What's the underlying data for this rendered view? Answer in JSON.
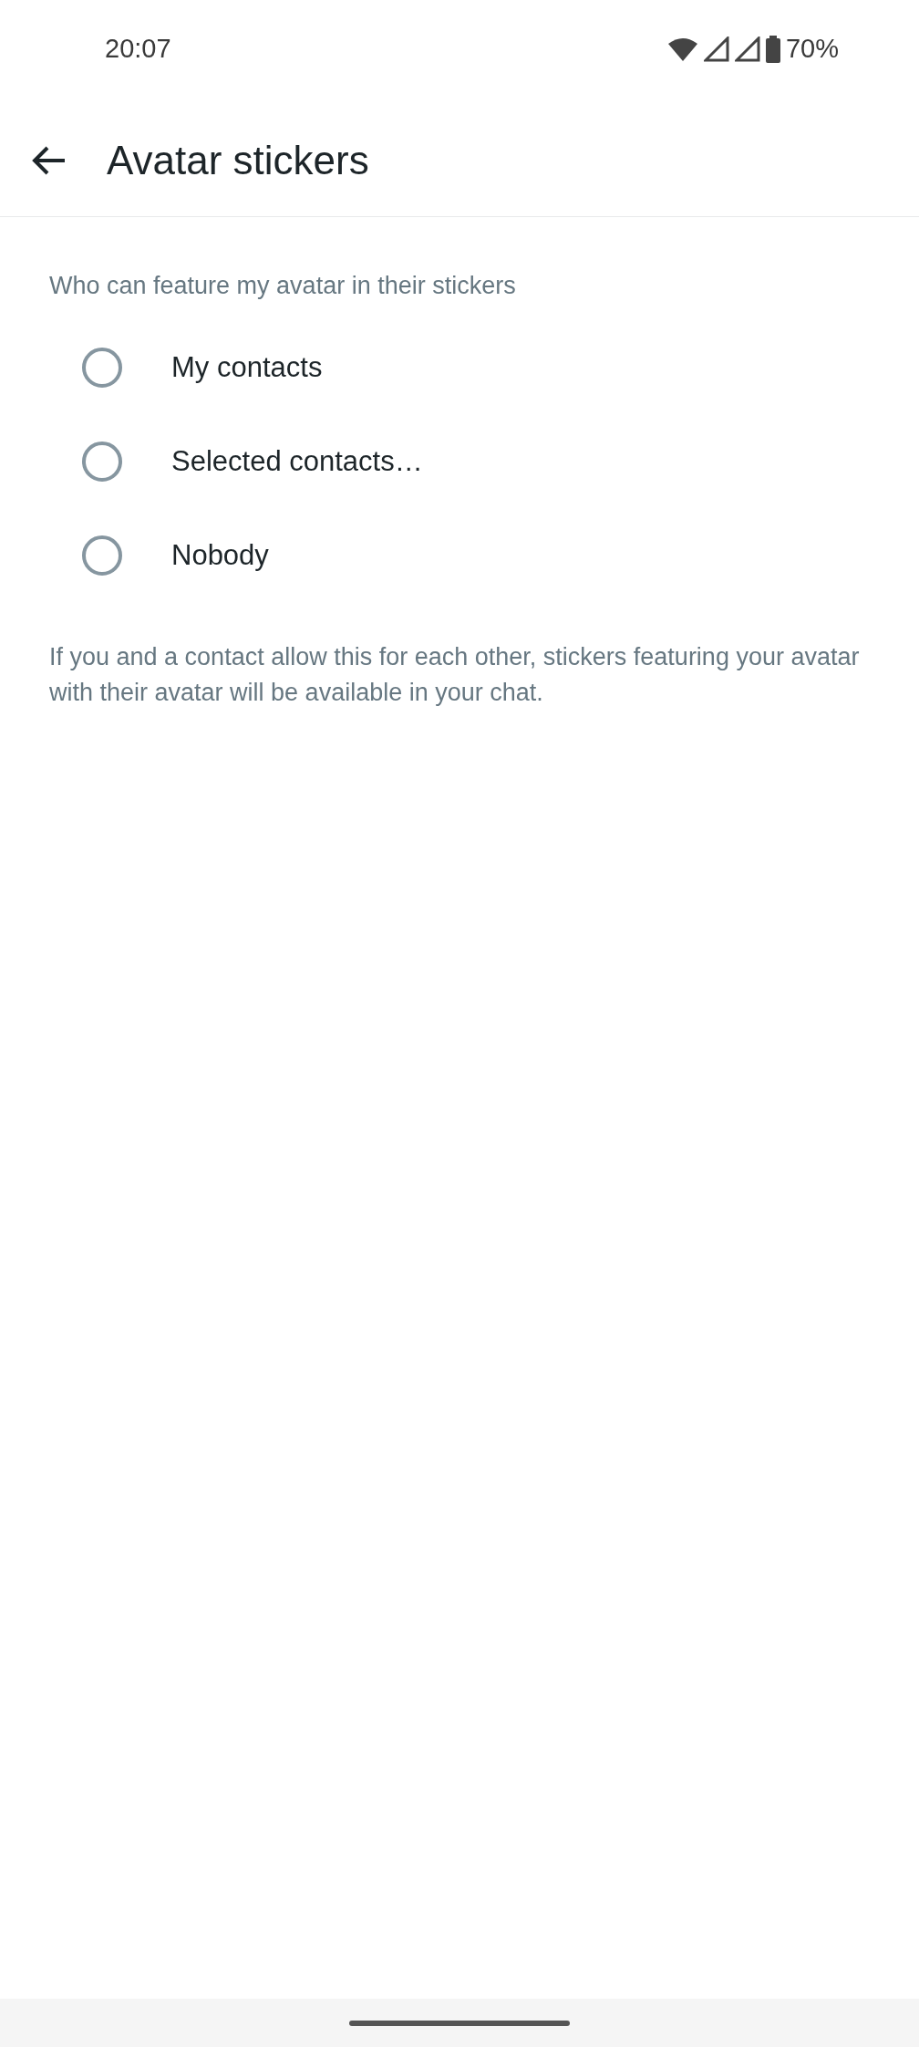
{
  "status_bar": {
    "time": "20:07",
    "battery": "70%"
  },
  "app_bar": {
    "title": "Avatar stickers"
  },
  "section": {
    "title": "Who can feature my avatar in their stickers"
  },
  "options": [
    {
      "label": "My contacts",
      "selected": false
    },
    {
      "label": "Selected contacts…",
      "selected": false
    },
    {
      "label": "Nobody",
      "selected": false
    }
  ],
  "footer": "If you and a contact allow this for each other, stickers featuring your avatar with their avatar will be available in your chat."
}
